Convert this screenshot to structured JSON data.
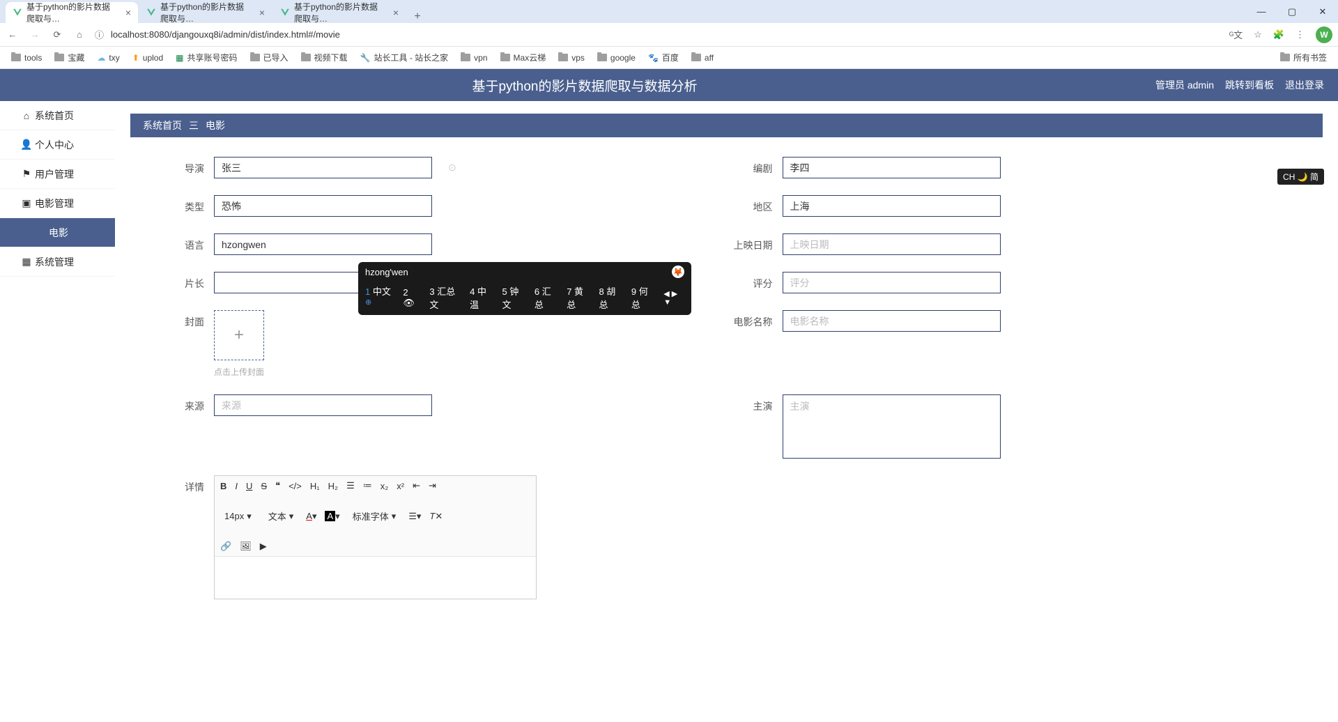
{
  "browser": {
    "tabs": [
      {
        "title": "基于python的影片数据爬取与…",
        "active": true
      },
      {
        "title": "基于python的影片数据爬取与…",
        "active": false
      },
      {
        "title": "基于python的影片数据爬取与…",
        "active": false
      }
    ],
    "url": "localhost:8080/djangouxq8i/admin/dist/index.html#/movie",
    "bookmarks": [
      "tools",
      "宝藏",
      "txy",
      "uplod",
      "共享账号密码",
      "已导入",
      "视频下载",
      "站长工具 - 站长之家",
      "vpn",
      "Max云梯",
      "vps",
      "google",
      "百度",
      "aff"
    ],
    "bookmarks_right": "所有书签",
    "avatar_letter": "W"
  },
  "app": {
    "title": "基于python的影片数据爬取与数据分析",
    "user_label": "管理员 admin",
    "dashboard_link": "跳转到看板",
    "logout": "退出登录"
  },
  "sidebar": [
    {
      "label": "系统首页",
      "icon": "home"
    },
    {
      "label": "个人中心",
      "icon": "person"
    },
    {
      "label": "用户管理",
      "icon": "flag"
    },
    {
      "label": "电影管理",
      "icon": "movie"
    },
    {
      "label": "电影",
      "icon": "",
      "active": true
    },
    {
      "label": "系统管理",
      "icon": "grid"
    }
  ],
  "breadcrumb": {
    "home": "系统首页",
    "sep": "三",
    "current": "电影"
  },
  "form": {
    "director_label": "导演",
    "director_value": "张三",
    "writer_label": "编剧",
    "writer_value": "李四",
    "genre_label": "类型",
    "genre_value": "恐怖",
    "region_label": "地区",
    "region_value": "上海",
    "language_label": "语言",
    "language_value": "hzongwen",
    "release_label": "上映日期",
    "release_placeholder": "上映日期",
    "duration_label": "片长",
    "rating_label": "评分",
    "rating_placeholder": "评分",
    "cover_label": "封面",
    "cover_hint": "点击上传封面",
    "name_label": "电影名称",
    "name_placeholder": "电影名称",
    "source_label": "来源",
    "source_placeholder": "来源",
    "actors_label": "主演",
    "actors_placeholder": "主演",
    "detail_label": "详情"
  },
  "editor": {
    "font_size": "14px",
    "text_label": "文本",
    "font_label": "标准字体"
  },
  "ime": {
    "input": "hzong'wen",
    "candidates": [
      "1 中文",
      "2 👁",
      "3 汇总文",
      "4 中温",
      "5 钟文",
      "6 汇总",
      "7 黄总",
      "8 胡总",
      "9 何总"
    ],
    "indicator": "CH 🌙 简"
  }
}
